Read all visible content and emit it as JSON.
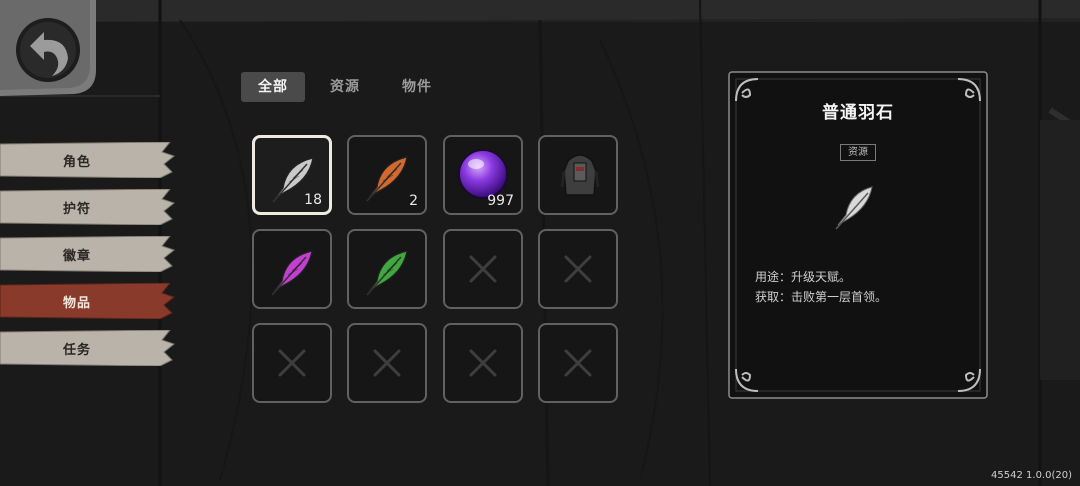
{
  "back_button": {
    "icon": "back-arrow-icon"
  },
  "side_menu": [
    {
      "label": "角色",
      "active": false
    },
    {
      "label": "护符",
      "active": false
    },
    {
      "label": "徽章",
      "active": false
    },
    {
      "label": "物品",
      "active": true
    },
    {
      "label": "任务",
      "active": false
    }
  ],
  "filter_tabs": [
    {
      "label": "全部",
      "active": true
    },
    {
      "label": "资源",
      "active": false
    },
    {
      "label": "物件",
      "active": false
    }
  ],
  "inventory": [
    {
      "item": "white-feather",
      "count": "18",
      "selected": true,
      "color": "#c9c9c9"
    },
    {
      "item": "orange-feather",
      "count": "2",
      "selected": false,
      "color": "#d2692e"
    },
    {
      "item": "purple-orb",
      "count": "997",
      "selected": false,
      "color": "#7a2fd6"
    },
    {
      "item": "dark-armor",
      "count": "",
      "selected": false,
      "color": "#4a4a4a"
    },
    {
      "item": "purple-feather",
      "count": "",
      "selected": false,
      "color": "#c23fd0"
    },
    {
      "item": "green-feather",
      "count": "",
      "selected": false,
      "color": "#3fa83f"
    },
    {
      "item": "empty",
      "count": "",
      "selected": false
    },
    {
      "item": "empty",
      "count": "",
      "selected": false
    },
    {
      "item": "empty",
      "count": "",
      "selected": false
    },
    {
      "item": "empty",
      "count": "",
      "selected": false
    },
    {
      "item": "empty",
      "count": "",
      "selected": false
    },
    {
      "item": "empty",
      "count": "",
      "selected": false
    }
  ],
  "details": {
    "title": "普通羽石",
    "tag": "资源",
    "usage": "用途：升级天赋。",
    "source": "获取：击败第一层首领。",
    "icon": "white-feather-icon"
  },
  "version": "45542 1.0.0(20)",
  "colors": {
    "active_tab": "#8a3a2a",
    "inactive_tab": "#b9b3a9",
    "selected_border": "#efeae0"
  }
}
